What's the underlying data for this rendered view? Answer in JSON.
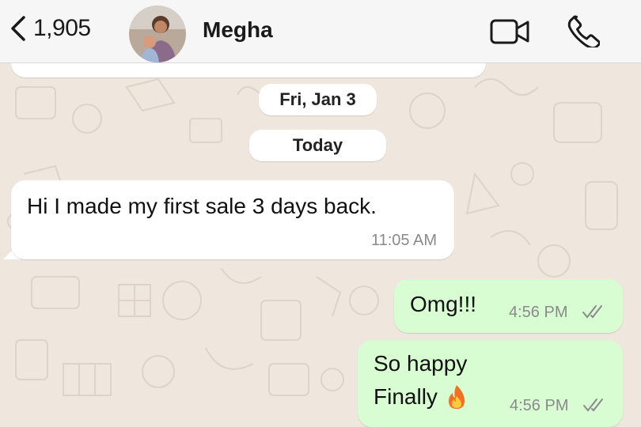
{
  "header": {
    "back_count": "1,905",
    "contact_name": "Megha"
  },
  "chat": {
    "date_chips": [
      "Fri, Jan 3",
      "Today"
    ],
    "messages": [
      {
        "direction": "incoming",
        "text": "Hi I made my first sale 3 days back.",
        "time": "11:05 AM"
      },
      {
        "direction": "outgoing",
        "text": "Omg!!!",
        "time": "4:56 PM",
        "status": "read"
      },
      {
        "direction": "outgoing",
        "lines": [
          "So happy",
          "Finally"
        ],
        "emoji": "fire-icon",
        "time": "4:56 PM",
        "status": "read"
      }
    ]
  },
  "colors": {
    "header_bg": "#f6f6f6",
    "wallpaper_bg": "#efe7de",
    "incoming_bubble": "#ffffff",
    "outgoing_bubble": "#d9fdd3",
    "read_ticks": "#8a8a8a"
  }
}
